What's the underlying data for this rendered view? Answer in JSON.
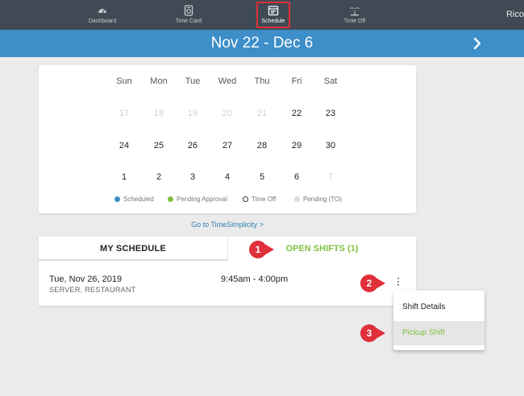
{
  "nav": {
    "items": [
      {
        "label": "Dashboard",
        "icon": "gauge-icon"
      },
      {
        "label": "Time Card",
        "icon": "timecard-icon"
      },
      {
        "label": "Schedule",
        "icon": "calendar-icon"
      },
      {
        "label": "Time Off",
        "icon": "palm-tree-icon"
      }
    ],
    "user": "Rico"
  },
  "date_range": "Nov 22 - Dec 6",
  "calendar": {
    "weekdays": [
      "Sun",
      "Mon",
      "Tue",
      "Wed",
      "Thu",
      "Fri",
      "Sat"
    ],
    "weeks": [
      [
        {
          "d": "17",
          "muted": true
        },
        {
          "d": "18",
          "muted": true
        },
        {
          "d": "19",
          "muted": true
        },
        {
          "d": "20",
          "muted": true
        },
        {
          "d": "21",
          "muted": true
        },
        {
          "d": "22",
          "muted": false
        },
        {
          "d": "23",
          "muted": false
        }
      ],
      [
        {
          "d": "24",
          "muted": false
        },
        {
          "d": "25",
          "muted": false
        },
        {
          "d": "26",
          "muted": false
        },
        {
          "d": "27",
          "muted": false
        },
        {
          "d": "28",
          "muted": false
        },
        {
          "d": "29",
          "muted": false
        },
        {
          "d": "30",
          "muted": false
        }
      ],
      [
        {
          "d": "1",
          "muted": false
        },
        {
          "d": "2",
          "muted": false
        },
        {
          "d": "3",
          "muted": false
        },
        {
          "d": "4",
          "muted": false
        },
        {
          "d": "5",
          "muted": false
        },
        {
          "d": "6",
          "muted": false
        },
        {
          "d": "7",
          "muted": true
        }
      ]
    ],
    "legend": [
      {
        "label": "Scheduled",
        "color": "#3d8ec9"
      },
      {
        "label": "Pending Approval",
        "color": "#7fc241"
      },
      {
        "label": "Time Off",
        "color": "outline"
      },
      {
        "label": "Pending (TO)",
        "color": "#dddddd"
      }
    ]
  },
  "timesimplicity_link": "Go to TimeSimplicity >",
  "tabs": {
    "my_schedule": "MY SCHEDULE",
    "open_shifts": "OPEN SHIFTS (1)"
  },
  "shift": {
    "date": "Tue, Nov 26, 2019",
    "role": "SERVER, RESTAURANT",
    "time": "9:45am - 4:00pm"
  },
  "menu": {
    "details": "Shift Details",
    "pickup": "Pickup Shift"
  },
  "callouts": [
    "1",
    "2",
    "3"
  ],
  "colors": {
    "nav_bg": "#3f4a54",
    "date_bar": "#3d8ec9",
    "accent_green": "#7fc241",
    "callout_red": "#e0303a"
  }
}
